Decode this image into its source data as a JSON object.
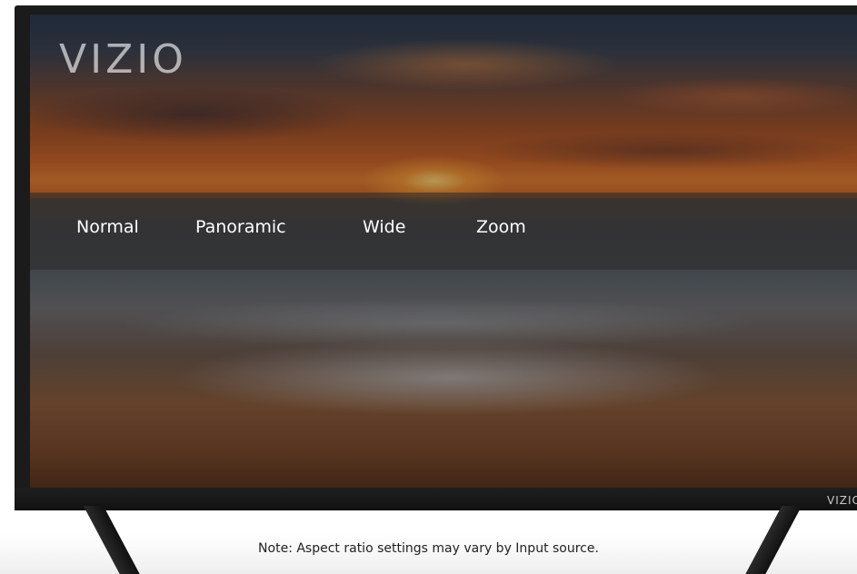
{
  "screen": {
    "logo": "VIZIO",
    "aspect_menu": {
      "items": [
        "Normal",
        "Panoramic",
        "Wide",
        "Zoom"
      ]
    }
  },
  "bezel": {
    "logo": "VIZIO"
  },
  "note": "Note: Aspect ratio settings may vary by Input source."
}
